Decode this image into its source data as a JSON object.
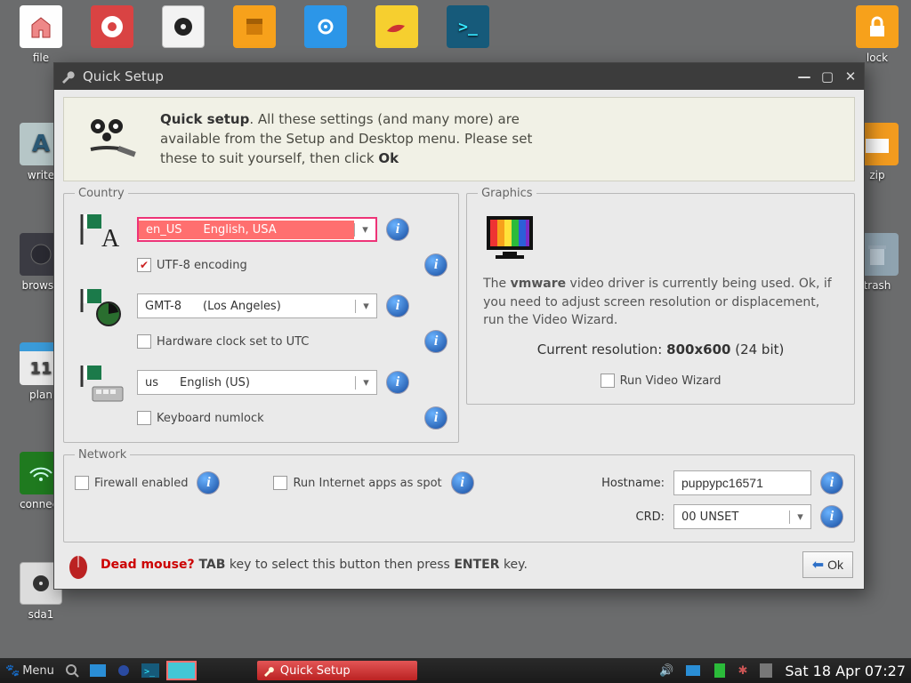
{
  "desktop": {
    "top_row": [
      {
        "label": "file",
        "bg": "#fefefe",
        "icon": "home"
      },
      {
        "label": "",
        "bg": "#d94343",
        "icon": "lifering"
      },
      {
        "label": "",
        "bg": "#f3f3f3",
        "icon": "disk"
      },
      {
        "label": "",
        "bg": "#f7a11b",
        "icon": "package"
      },
      {
        "label": "",
        "bg": "#2c96e8",
        "icon": "gear"
      },
      {
        "label": "",
        "bg": "#f6cf2f",
        "icon": "lamp"
      },
      {
        "label": "",
        "bg": "#165a7a",
        "icon": "term"
      }
    ],
    "lock_label": "lock",
    "left_col": [
      {
        "label": "write",
        "bg": "#b6c6c7",
        "icon": "write"
      },
      {
        "label": "browse",
        "bg": "#3b3b43",
        "icon": "globe"
      },
      {
        "label": "plan",
        "bg": "#eaeaea",
        "icon": "calendar",
        "badge": "11"
      },
      {
        "label": "connect",
        "bg": "#1f7a1f",
        "icon": "wifi"
      },
      {
        "label": "sda1",
        "bg": "#dcdcdc",
        "icon": "drive"
      }
    ],
    "right_col": [
      {
        "label": "zip",
        "bg": "#f29b1f",
        "icon": "folder"
      },
      {
        "label": "trash",
        "bg": "#8fa3b0",
        "icon": "trash"
      }
    ]
  },
  "taskbar": {
    "menu": "Menu",
    "active_task": "Quick Setup",
    "clock": "Sat 18 Apr 07:27"
  },
  "win": {
    "title": "Quick Setup",
    "intro_prefix": "Quick setup",
    "intro_body": ". All these settings (and many more) are available from the Setup and Desktop menu. Please set these to suit yourself, then click ",
    "intro_ok": "Ok",
    "country_legend": "Country",
    "graphics_legend": "Graphics",
    "network_legend": "Network",
    "locale": {
      "code": "en_US",
      "name": "English, USA"
    },
    "utf8": "UTF-8 encoding",
    "tz": {
      "code": "GMT-8",
      "name": "(Los Angeles)"
    },
    "hwclock": "Hardware clock set to UTC",
    "kb": {
      "code": "us",
      "name": "English (US)"
    },
    "numlock": "Keyboard numlock",
    "gfx_line1_a": "The ",
    "gfx_line1_b": "vmware",
    "gfx_line1_c": " video driver is currently being used. Ok, if you need to adjust screen resolution or displacement, run the Video Wizard.",
    "gfx_res_label": "Current resolution: ",
    "gfx_res_value": "800x600",
    "gfx_res_depth": "   (24 bit)",
    "gfx_run": "Run Video Wizard",
    "firewall": "Firewall enabled",
    "spot": "Run Internet apps as spot",
    "hostname_label": "Hostname:",
    "hostname": "puppypc16571",
    "crd_label": "CRD:",
    "crd_value": "00 UNSET",
    "mouse_a": "Dead mouse?",
    "mouse_b": " TAB",
    "mouse_c": " key to select this button then press ",
    "mouse_d": "ENTER",
    "mouse_e": " key.",
    "ok_label": "Ok"
  }
}
